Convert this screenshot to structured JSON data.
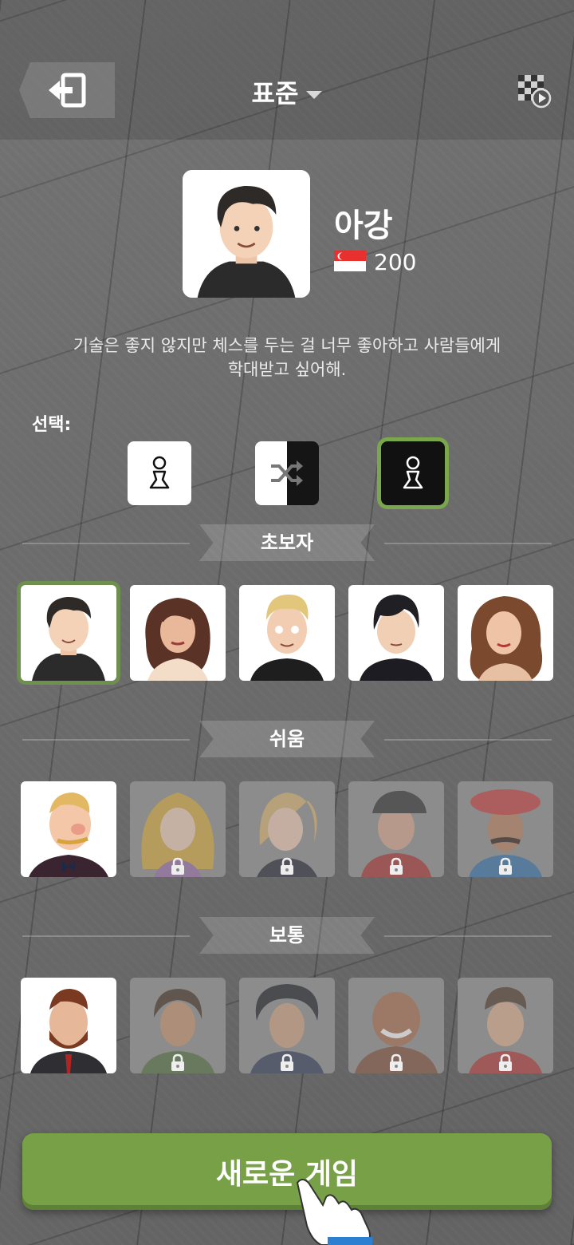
{
  "header": {
    "mode_label": "표준"
  },
  "profile": {
    "name": "아강",
    "rating": "200",
    "description_line1": "기술은 좋지 않지만 체스를 두는 걸 너무 좋아하고 사람들에게",
    "description_line2": "학대받고 싶어해."
  },
  "color_select": {
    "label": "선택:",
    "options": [
      "white",
      "random",
      "black"
    ],
    "selected": "black"
  },
  "sections": [
    {
      "title": "초보자",
      "bots": [
        "bot-1",
        "bot-2",
        "bot-3",
        "bot-4",
        "bot-5"
      ],
      "locked": [
        false,
        false,
        false,
        false,
        false
      ],
      "selected_index": 0
    },
    {
      "title": "쉬움",
      "bots": [
        "bot-6",
        "bot-7",
        "bot-8",
        "bot-9",
        "bot-10"
      ],
      "locked": [
        false,
        true,
        true,
        true,
        true
      ]
    },
    {
      "title": "보통",
      "bots": [
        "bot-11",
        "bot-12",
        "bot-13",
        "bot-14",
        "bot-15"
      ],
      "locked": [
        false,
        true,
        true,
        true,
        true
      ]
    }
  ],
  "buttons": {
    "new_game": "새로운 게임"
  },
  "colors": {
    "accent_green": "#78a047",
    "selected_outline": "#7aa64c"
  },
  "icons": [
    "exit-icon",
    "caret-down-icon",
    "replay-icon",
    "flag-icon",
    "pawn-icon",
    "shuffle-icon",
    "lock-icon",
    "pointer-hand-icon"
  ]
}
